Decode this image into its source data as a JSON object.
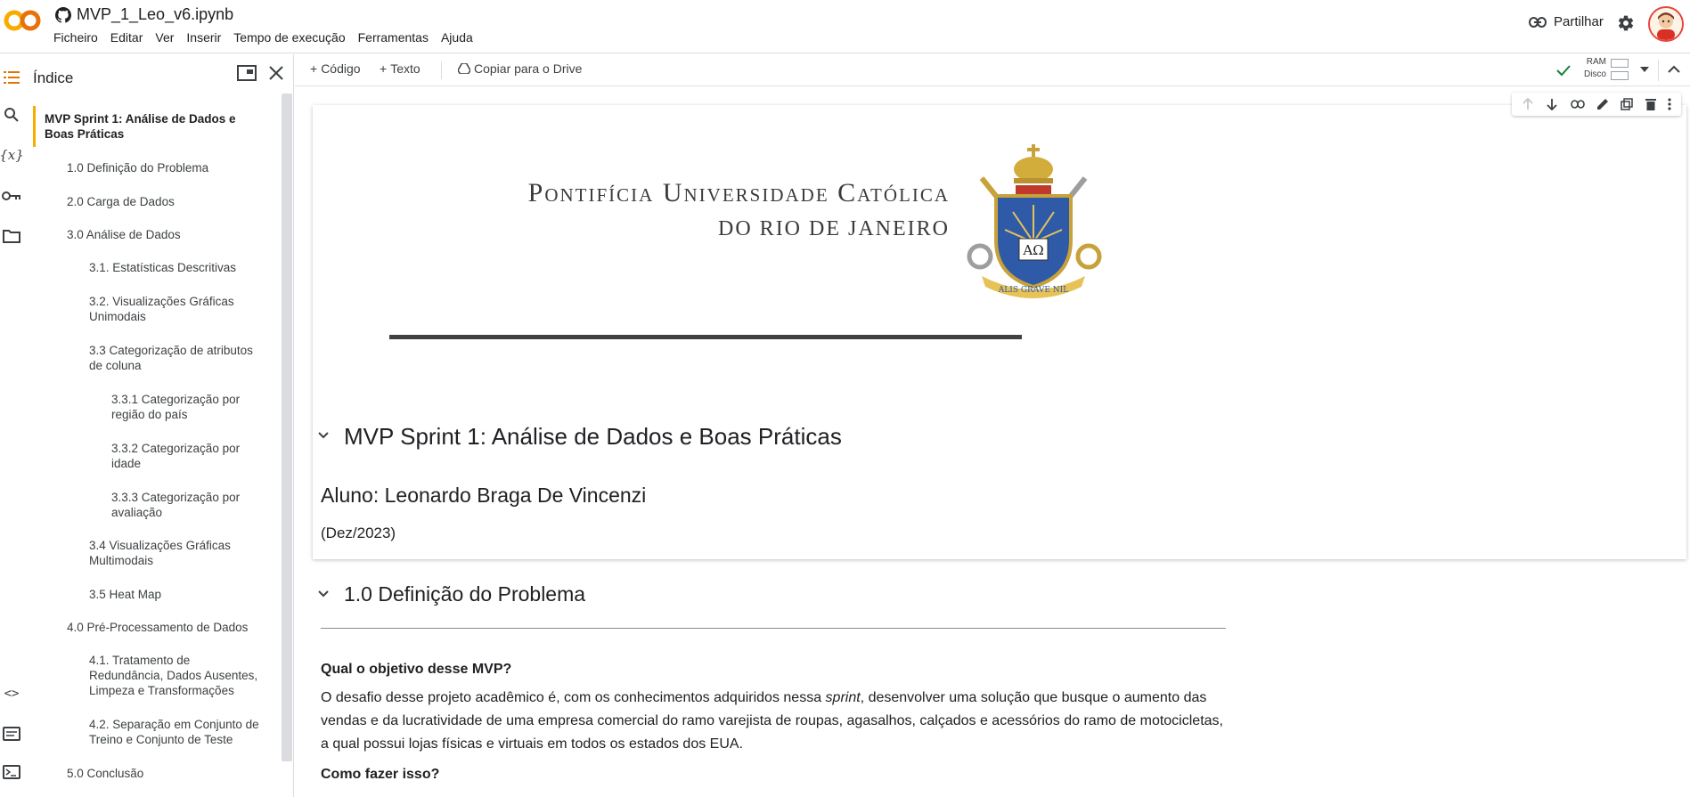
{
  "header": {
    "notebook_title": "MVP_1_Leo_v6.ipynb",
    "menu": [
      "Ficheiro",
      "Editar",
      "Ver",
      "Inserir",
      "Tempo de execução",
      "Ferramentas",
      "Ajuda"
    ],
    "share_label": "Partilhar",
    "logo_text": "CO"
  },
  "toc": {
    "title": "Índice",
    "items": [
      {
        "label": "MVP Sprint 1: Análise de Dados e Boas Práticas",
        "level": 1,
        "active": true
      },
      {
        "label": "1.0 Definição do Problema",
        "level": 2
      },
      {
        "label": "2.0 Carga de Dados",
        "level": 2
      },
      {
        "label": "3.0 Análise de Dados",
        "level": 2
      },
      {
        "label": "3.1. Estatísticas Descritivas",
        "level": 3
      },
      {
        "label": "3.2. Visualizações Gráficas Unimodais",
        "level": 3
      },
      {
        "label": "3.3 Categorização de atributos de coluna",
        "level": 3
      },
      {
        "label": "3.3.1 Categorização por região do país",
        "level": 4
      },
      {
        "label": "3.3.2 Categorização por idade",
        "level": 4
      },
      {
        "label": "3.3.3 Categorização por avaliação",
        "level": 4
      },
      {
        "label": "3.4 Visualizações Gráficas Multimodais",
        "level": 3
      },
      {
        "label": "3.5 Heat Map",
        "level": 3
      },
      {
        "label": "4.0 Pré-Processamento de Dados",
        "level": 2
      },
      {
        "label": "4.1. Tratamento de Redundância, Dados Ausentes, Limpeza e Transformações",
        "level": 3
      },
      {
        "label": "4.2. Separação em Conjunto de Treino e Conjunto de Teste",
        "level": 3
      },
      {
        "label": "5.0 Conclusão",
        "level": 2
      }
    ]
  },
  "toolbar": {
    "add_code": "Código",
    "add_text": "Texto",
    "copy_drive": "Copiar para o Drive",
    "ram_label": "RAM",
    "disk_label": "Disco"
  },
  "cell1": {
    "logo_line1": "Pontifícia Universidade Católica",
    "logo_line2": "do Rio de Janeiro",
    "seal_text": "ΑΩ",
    "seal_motto": "ALIS GRAVE NIL",
    "heading": "MVP Sprint 1: Análise de Dados e Boas Práticas",
    "student": "Aluno: Leonardo Braga De Vincenzi",
    "date": "(Dez/2023)"
  },
  "section1": {
    "heading": "1.0 Definição do Problema",
    "q1": "Qual o objetivo desse MVP?",
    "p1_before": "O desafio desse projeto acadêmico é, com os conhecimentos adquiridos nessa ",
    "p1_italic": "sprint",
    "p1_after": ", desenvolver uma solução que busque o aumento das",
    "p1_line2": "vendas e da lucratividade de uma empresa comercial do ramo varejista de roupas, agasalhos, calçados e acessórios do ramo de motocicletas,",
    "p1_line3": "a qual possui lojas físicas e virtuais em todos os estados dos EUA.",
    "q2": "Como fazer isso?"
  },
  "colors": {
    "accent_orange": "#f9ab00",
    "logo_gold": "#c7a23a",
    "logo_dark": "#3a3a3a"
  }
}
